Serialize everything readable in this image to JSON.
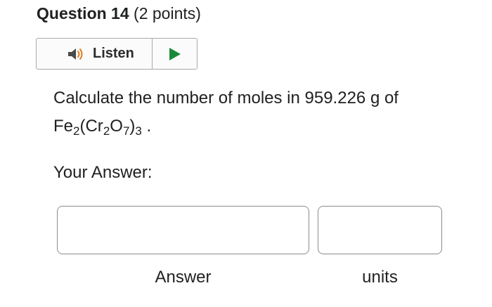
{
  "question": {
    "title": "Question 14",
    "points": "(2 points)"
  },
  "listen": {
    "label": "Listen",
    "icons": {
      "speaker": "speaker-icon",
      "play": "play-icon"
    },
    "colors": {
      "speaker_body": "#4a4a4a",
      "speaker_wave": "#e07b24",
      "play": "#1a8a3a"
    }
  },
  "prompt": {
    "text_before": "Calculate the number of moles in 959.226 g of",
    "formula": {
      "fe": "Fe",
      "fe_sub": "2",
      "cr_open": "(Cr",
      "cr_sub": "2",
      "o": "O",
      "o_sub": "7",
      "close": ")",
      "group_sub": "3",
      "end": " ."
    }
  },
  "answer_section": {
    "label": "Your Answer:",
    "answer_value": "",
    "units_value": "",
    "answer_caption": "Answer",
    "units_caption": "units"
  }
}
